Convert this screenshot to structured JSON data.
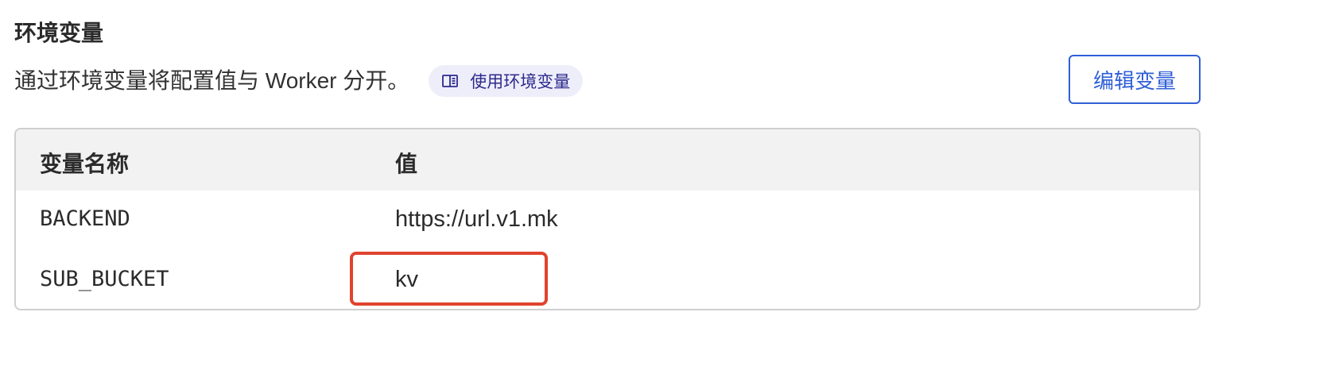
{
  "section": {
    "title": "环境变量",
    "description": "通过环境变量将配置值与 Worker 分开。",
    "doc_link_label": "使用环境变量",
    "doc_icon": "book-icon",
    "edit_button_label": "编辑变量"
  },
  "table": {
    "columns": [
      "变量名称",
      "值"
    ],
    "rows": [
      {
        "name": "BACKEND",
        "value": "https://url.v1.mk"
      },
      {
        "name": "SUB_BUCKET",
        "value": "kv"
      }
    ]
  },
  "colors": {
    "accent": "#2f5fd6",
    "pill_bg": "#eeeefb",
    "pill_text": "#2d2a8c",
    "highlight": "#e0432e",
    "header_bg": "#f2f2f2"
  }
}
